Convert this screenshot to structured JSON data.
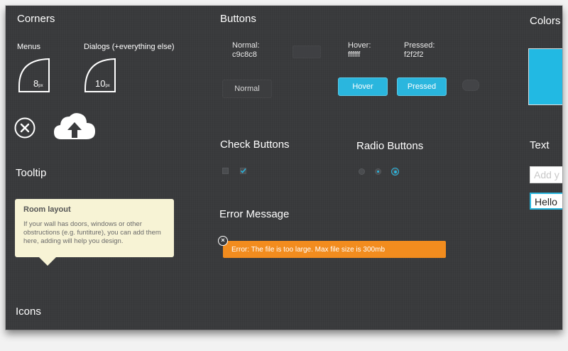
{
  "sections": {
    "corners": "Corners",
    "buttons": "Buttons",
    "colors": "Colors",
    "check_buttons": "Check Buttons",
    "radio_buttons": "Radio Buttons",
    "tooltip": "Tooltip",
    "error_message": "Error Message",
    "text": "Text",
    "icons": "Icons"
  },
  "corners": {
    "menus_label": "Menus",
    "dialogs_label": "Dialogs (+everything else)",
    "menus_value": "8",
    "dialogs_value": "10",
    "unit": "px"
  },
  "buttons": {
    "normal_label": "Normal:",
    "normal_color": "c9c8c8",
    "hover_label": "Hover:",
    "hover_color": "ffffff",
    "pressed_label": "Pressed:",
    "pressed_color": "f2f2f2",
    "normal_button": "Normal",
    "hover_button": "Hover",
    "pressed_button": "Pressed"
  },
  "tooltip": {
    "title": "Room layout",
    "body": "If your wall has doors, windows or other obstructions (e.g. funtiture), you can add them here, adding will help you design."
  },
  "error": {
    "text": "Error: The file is too large. Max file size is 300mb"
  },
  "text_inputs": {
    "placeholder": "Add y",
    "value": "Hello"
  },
  "colors": {
    "background": "#3a3b3d",
    "accent_blue": "#2ab6de",
    "error_orange": "#f28c1e",
    "tooltip_bg": "#f7f3d5"
  },
  "icons": {
    "close_circle": "close-circle-icon",
    "cloud_upload": "cloud-upload-icon"
  }
}
